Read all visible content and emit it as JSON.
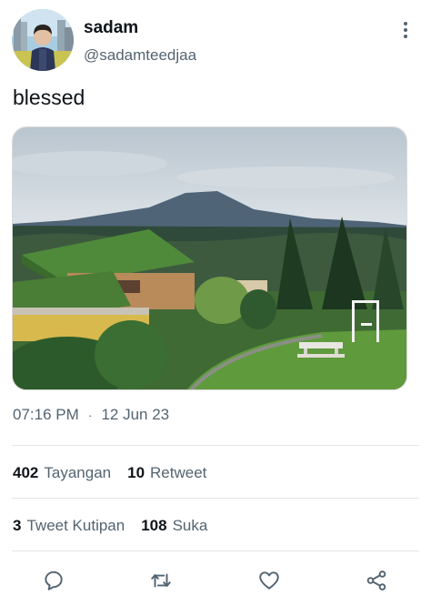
{
  "author": {
    "display_name": "sadam",
    "handle": "@sadamteedjaa",
    "avatar_icon": "profile-photo"
  },
  "tweet": {
    "text": "blessed",
    "media_description_icon": "landscape-photo",
    "time": "07:16 PM",
    "separator": "·",
    "date": "12 Jun 23"
  },
  "stats": {
    "views_count": "402",
    "views_label": "Tayangan",
    "retweets_count": "10",
    "retweets_label": "Retweet",
    "quotes_count": "3",
    "quotes_label": "Tweet Kutipan",
    "likes_count": "108",
    "likes_label": "Suka"
  },
  "actions": {
    "reply_icon": "reply-icon",
    "retweet_icon": "retweet-icon",
    "like_icon": "heart-icon",
    "share_icon": "share-icon"
  },
  "colors": {
    "text_primary": "#0f1419",
    "text_secondary": "#536471",
    "divider": "#e1e6ea"
  }
}
